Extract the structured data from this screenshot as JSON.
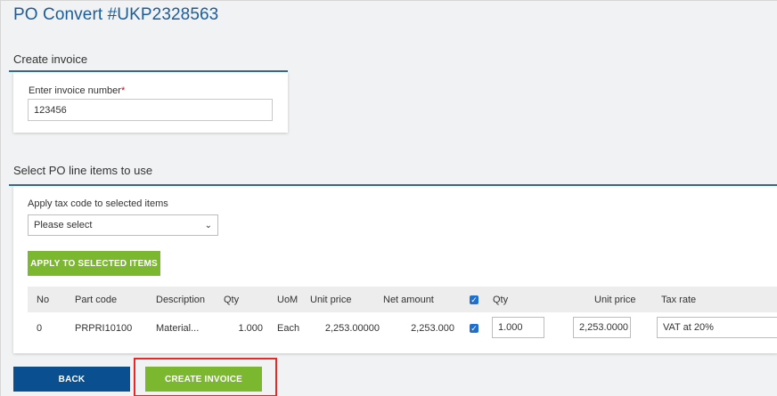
{
  "header": {
    "title": "PO Convert #UKP2328563"
  },
  "create_invoice": {
    "section_title": "Create invoice",
    "field_label": "Enter invoice number",
    "required_mark": "*",
    "invoice_value": "123456"
  },
  "line_items": {
    "section_title": "Select PO line items to use",
    "tax_label": "Apply tax code to selected items",
    "tax_select_value": "Please select",
    "apply_button": "APPLY TO SELECTED ITEMS",
    "columns": [
      "No",
      "Part code",
      "Description",
      "Qty",
      "UoM",
      "Unit price",
      "Net amount",
      "",
      "Qty",
      "Unit price",
      "Tax rate"
    ],
    "header_checkbox_checked": true,
    "rows": [
      {
        "no": "0",
        "part_code": "PRPRI10100",
        "description": "Material...",
        "qty": "1.000",
        "uom": "Each",
        "unit_price": "2,253.00000",
        "net_amount": "2,253.000",
        "checked": true,
        "edit_qty": "1.000",
        "edit_unit_price": "2,253.0000",
        "tax_rate": "VAT at 20%"
      }
    ]
  },
  "actions": {
    "back": "BACK",
    "create_invoice": "CREATE INVOICE"
  },
  "colors": {
    "title_blue": "#1c5d99",
    "green": "#7cb82f",
    "navy": "#0a4f8f",
    "highlight_red": "#e02b2b",
    "checkbox_blue": "#1d6fd1"
  }
}
